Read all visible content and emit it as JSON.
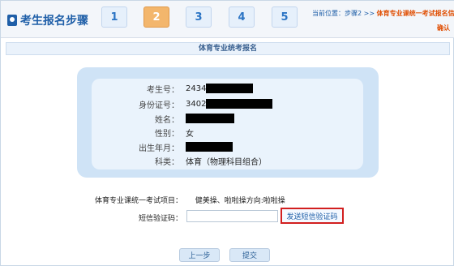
{
  "header": {
    "brand": "考生报名步骤",
    "steps": [
      "1",
      "2",
      "3",
      "4",
      "5"
    ],
    "active_step": "2",
    "breadcrumb_prefix": "当前位置：步骤2 >>",
    "breadcrumb_highlight": "体育专业课统一考试报名信息",
    "breadcrumb_tail": "确认"
  },
  "section": {
    "title": "体育专业统考报名"
  },
  "info": {
    "exam_no_label": "考生号：",
    "exam_no_prefix": "2434",
    "id_label": "身份证号：",
    "id_prefix": "3402",
    "name_label": "姓名：",
    "gender_label": "性别：",
    "gender_value": "女",
    "birth_label": "出生年月：",
    "subject_label": "科类：",
    "subject_value": "体育（物理科目组合）"
  },
  "form": {
    "exam_items_label": "体育专业课统一考试项目：",
    "exam_items_value": "健美操、啦啦操方向:啦啦操",
    "sms_label": "短信验证码：",
    "sms_value": "",
    "sms_button": "发送短信验证码"
  },
  "buttons": {
    "prev": "上一步",
    "submit": "提交"
  },
  "colors": {
    "brand_blue": "#1f5fa8",
    "active_step_orange": "#f3b66c",
    "highlight_red": "#d21f1f",
    "breadcrumb_orange": "#e04d00"
  }
}
